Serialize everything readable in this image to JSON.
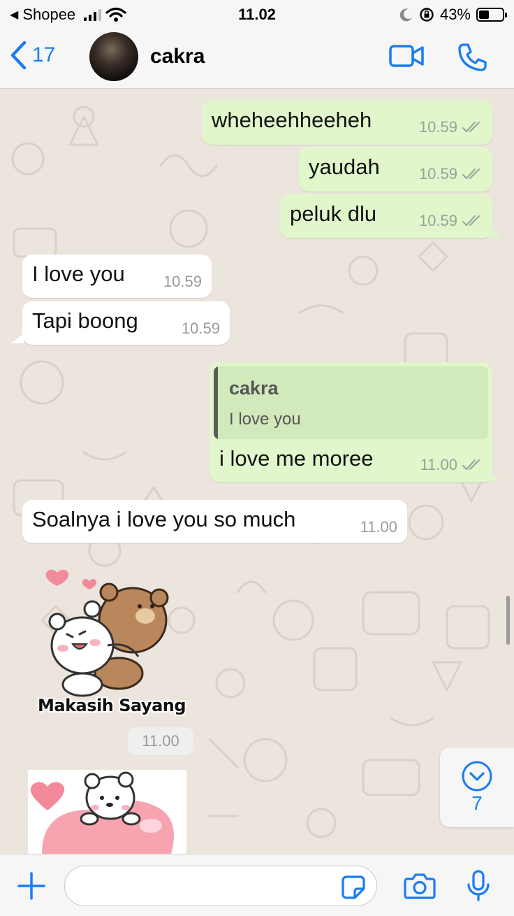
{
  "status_bar": {
    "back_app": "Shopee",
    "time": "11.02",
    "battery": "43%",
    "battery_level": 0.43
  },
  "header": {
    "back_count": "17",
    "contact_name": "cakra"
  },
  "messages": [
    {
      "direction": "out",
      "text": "wheheehheeheh",
      "time": "10.59",
      "status": "read"
    },
    {
      "direction": "out",
      "text": "yaudah",
      "time": "10.59",
      "status": "read"
    },
    {
      "direction": "out",
      "text": "peluk dlu",
      "time": "10.59",
      "status": "read"
    },
    {
      "direction": "in",
      "text": "I love you",
      "time": "10.59"
    },
    {
      "direction": "in",
      "text": "Tapi boong",
      "time": "10.59"
    },
    {
      "direction": "out",
      "text": "i love me moree",
      "time": "11.00",
      "status": "read",
      "reply_to": {
        "name": "cakra",
        "text": "I love you"
      }
    },
    {
      "direction": "in",
      "text": "Soalnya i love you so much",
      "time": "11.00"
    },
    {
      "direction": "in",
      "type": "sticker",
      "sticker": "bear-hug-sticker",
      "caption": "Makasih Sayang",
      "time": "11.00"
    },
    {
      "direction": "in",
      "type": "sticker",
      "sticker": "bear-heart-sticker"
    }
  ],
  "scroll_down": {
    "unread_count": "7"
  },
  "input": {
    "value": "",
    "placeholder": ""
  },
  "colors": {
    "accent": "#1a7cf2",
    "outgoing_bubble": "#e1f6cb",
    "incoming_bubble": "#ffffff",
    "chat_background": "#ece5dd"
  }
}
